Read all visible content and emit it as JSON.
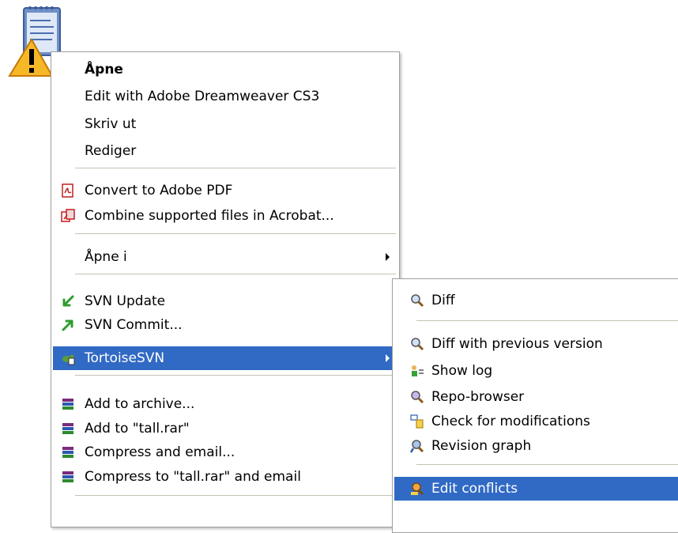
{
  "file_icon": {
    "icon": "text-file-with-warning-icon"
  },
  "main_menu": {
    "items": [
      {
        "label": "Åpne",
        "bold": true
      },
      {
        "label": "Edit with Adobe Dreamweaver CS3"
      },
      {
        "label": "Skriv ut"
      },
      {
        "label": "Rediger"
      },
      {
        "label": "Convert to Adobe PDF",
        "icon": "pdf-icon"
      },
      {
        "label": "Combine supported files in Acrobat...",
        "icon": "acrobat-combine-icon"
      },
      {
        "label": "Åpne i",
        "submenu": true
      },
      {
        "label": "SVN Update",
        "icon": "svn-update-icon"
      },
      {
        "label": "SVN Commit...",
        "icon": "svn-commit-icon"
      },
      {
        "label": "TortoiseSVN",
        "icon": "tortoisesvn-icon",
        "submenu": true,
        "highlighted": true
      },
      {
        "label": "Add to archive...",
        "icon": "winrar-icon"
      },
      {
        "label": "Add to \"tall.rar\"",
        "icon": "winrar-icon"
      },
      {
        "label": "Compress and email...",
        "icon": "winrar-icon"
      },
      {
        "label": "Compress to \"tall.rar\" and email",
        "icon": "winrar-icon"
      }
    ]
  },
  "sub_menu": {
    "items": [
      {
        "label": "Diff",
        "icon": "diff-magnifier-icon"
      },
      {
        "label": "Diff with previous version",
        "icon": "diff-magnifier-icon"
      },
      {
        "label": "Show log",
        "icon": "show-log-icon"
      },
      {
        "label": "Repo-browser",
        "icon": "repo-browser-icon"
      },
      {
        "label": "Check for modifications",
        "icon": "check-modifications-icon"
      },
      {
        "label": "Revision graph",
        "icon": "revision-graph-icon"
      },
      {
        "label": "Edit conflicts",
        "icon": "edit-conflicts-icon",
        "highlighted": true
      }
    ]
  },
  "colors": {
    "highlight": "#316ac5",
    "separator": "#c5c2b2",
    "menu_border": "#a0a0a0"
  }
}
